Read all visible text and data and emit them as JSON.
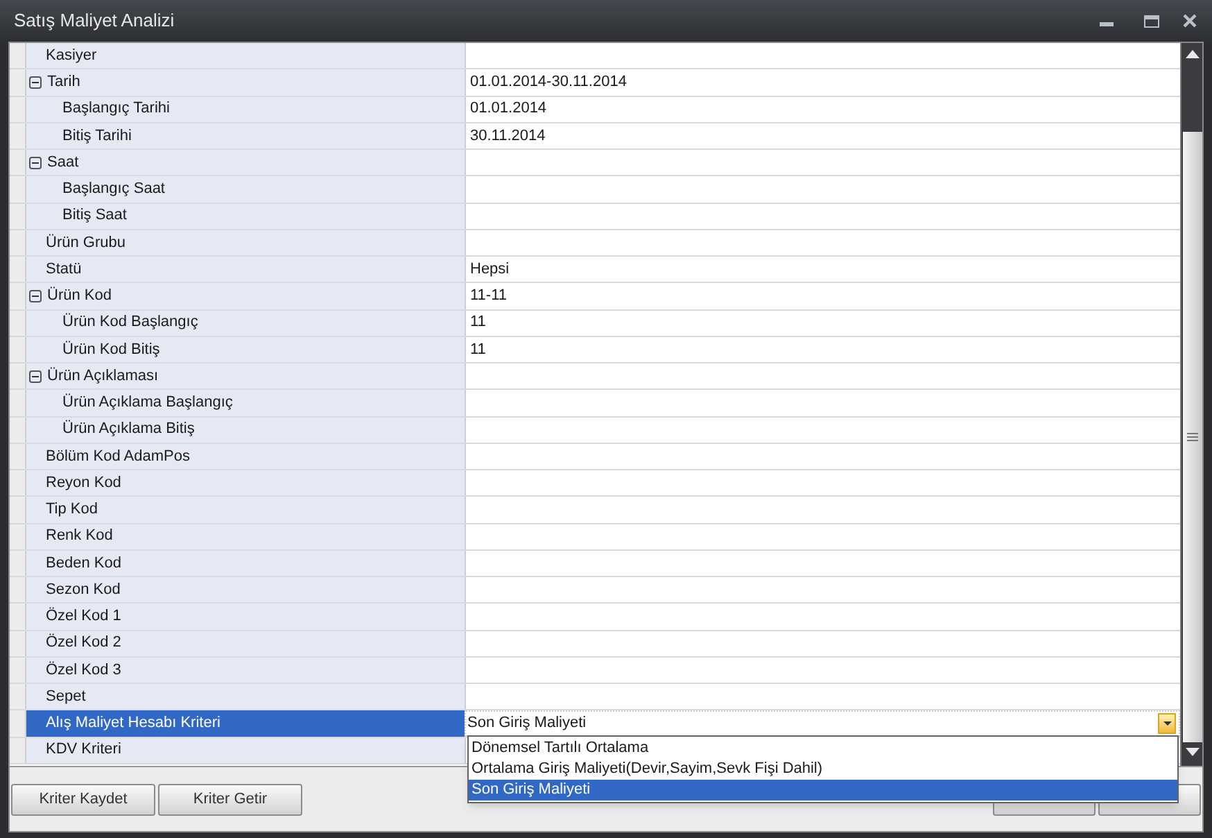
{
  "window": {
    "title": "Satış Maliyet Analizi"
  },
  "properties": [
    {
      "label": "Kasiyer",
      "selected": false
    },
    {
      "label": "Tarih",
      "value": "01.01.2014-30.11.2014",
      "selected": false,
      "expanded": true,
      "children": [
        {
          "label": "Başlangıç Tarihi",
          "value": "01.01.2014",
          "selected": false
        },
        {
          "label": "Bitiş Tarihi",
          "value": "30.11.2014",
          "selected": false
        }
      ]
    },
    {
      "label": "Saat",
      "selected": false,
      "expanded": true,
      "children": [
        {
          "label": "Başlangıç Saat",
          "selected": false
        },
        {
          "label": "Bitiş Saat",
          "selected": false
        }
      ]
    },
    {
      "label": "Ürün Grubu",
      "selected": false
    },
    {
      "label": "Statü",
      "value": "Hepsi",
      "selected": false
    },
    {
      "label": "Ürün Kod",
      "value": "11-11",
      "selected": false,
      "expanded": true,
      "children": [
        {
          "label": "Ürün Kod Başlangıç",
          "value": "11",
          "selected": false
        },
        {
          "label": "Ürün Kod Bitiş",
          "value": "11",
          "selected": false
        }
      ]
    },
    {
      "label": "Ürün Açıklaması",
      "selected": false,
      "expanded": true,
      "children": [
        {
          "label": "Ürün Açıklama Başlangıç",
          "selected": false
        },
        {
          "label": "Ürün Açıklama Bitiş",
          "selected": false
        }
      ]
    },
    {
      "label": "Bölüm Kod AdamPos",
      "selected": false
    },
    {
      "label": "Reyon Kod",
      "selected": false
    },
    {
      "label": "Tip Kod",
      "selected": false
    },
    {
      "label": "Renk Kod",
      "selected": false
    },
    {
      "label": "Beden Kod",
      "selected": false
    },
    {
      "label": "Sezon Kod",
      "selected": false
    },
    {
      "label": "Özel Kod 1",
      "selected": false
    },
    {
      "label": "Özel Kod 2",
      "selected": false
    },
    {
      "label": "Özel Kod 3",
      "selected": false
    },
    {
      "label": "Sepet",
      "selected": false
    },
    {
      "label": "Alış Maliyet Hesabı Kriteri",
      "value": "Son Giriş Maliyeti",
      "selected": true
    },
    {
      "label": "KDV Kriteri",
      "selected": false
    }
  ],
  "dropdown": {
    "options": [
      {
        "label": "Dönemsel Tartılı Ortalama",
        "selected": false
      },
      {
        "label": "Ortalama Giriş Maliyeti(Devir,Sayim,Sevk Fişi Dahil)",
        "selected": false
      },
      {
        "label": "Son Giriş Maliyeti",
        "selected": true
      }
    ]
  },
  "buttons_left": [
    "Kriter Kaydet",
    "Kriter Getir"
  ]
}
